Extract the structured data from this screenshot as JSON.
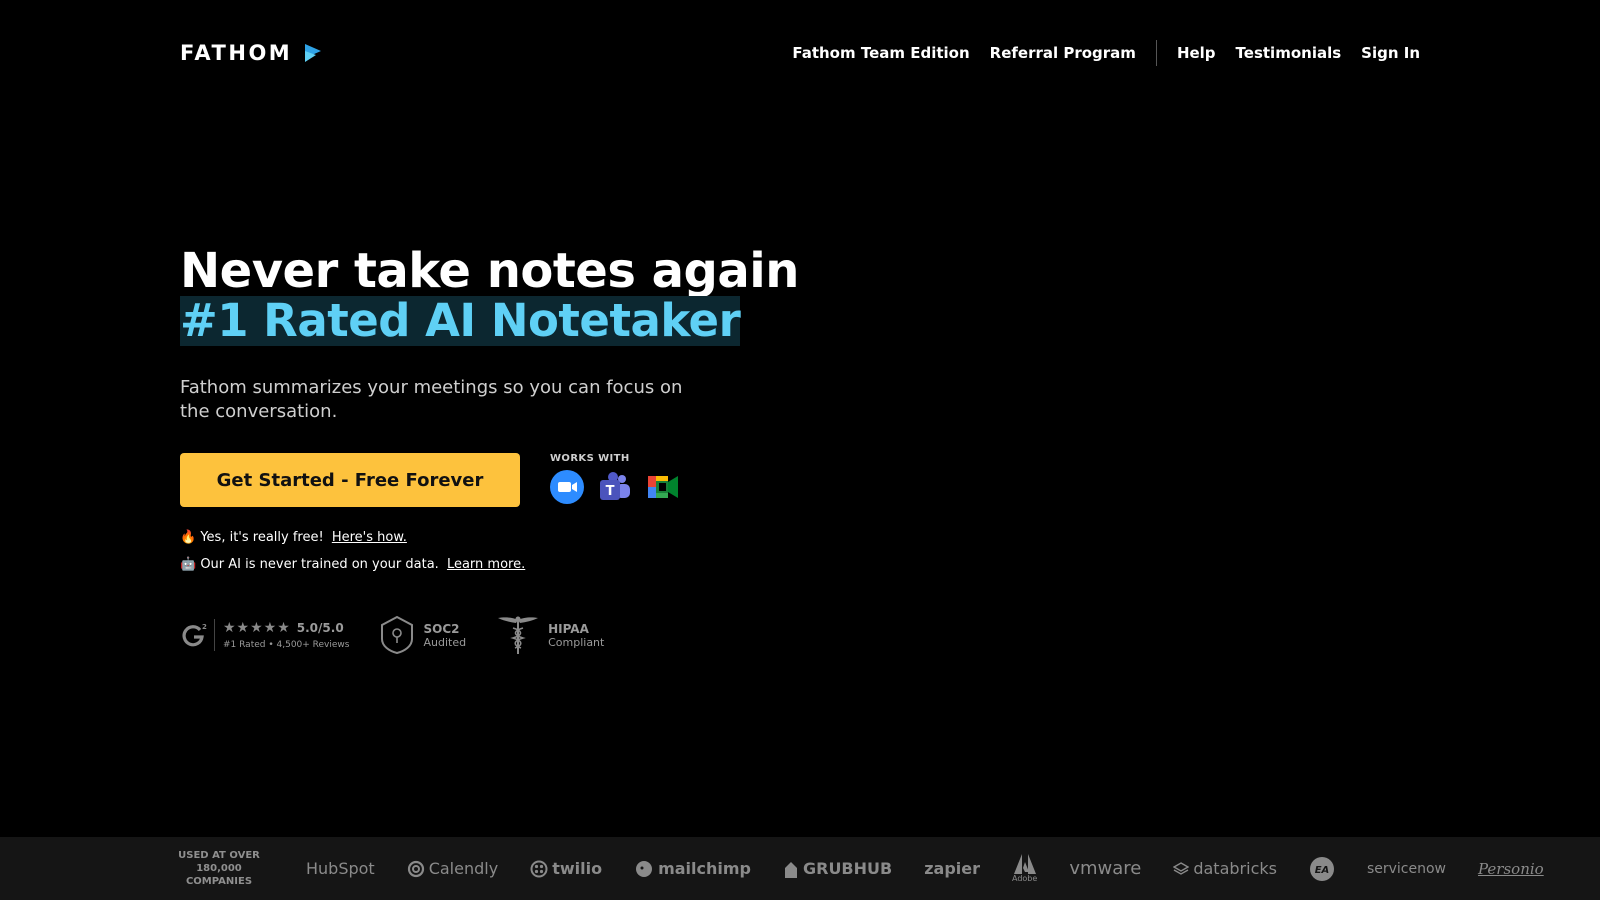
{
  "header": {
    "logo_text": "FATHOM",
    "nav": [
      "Fathom Team Edition",
      "Referral Program",
      "Help",
      "Testimonials",
      "Sign In"
    ]
  },
  "hero": {
    "headline": "Never take notes again",
    "subheadline": "#1 Rated AI Notetaker",
    "description": "Fathom summarizes your meetings so you can focus on the conversation.",
    "cta_label": "Get Started - Free Forever",
    "works_with_label": "WORKS WITH",
    "works_with_icons": [
      "zoom-icon",
      "microsoft-teams-icon",
      "google-meet-icon"
    ],
    "note1": {
      "emoji": "🔥",
      "text": "Yes, it's really free!",
      "link": "Here's how."
    },
    "note2": {
      "emoji": "🤖",
      "text": "Our AI is never trained on your data.",
      "link": "Learn more."
    }
  },
  "badges": {
    "g2": {
      "stars": "★★★★★",
      "rating": "5.0/5.0",
      "sub": "#1 Rated • 4,500+ Reviews"
    },
    "soc2": {
      "title": "SOC2",
      "sub": "Audited"
    },
    "hipaa": {
      "title": "HIPAA",
      "sub": "Compliant"
    }
  },
  "companies": {
    "label_line1": "USED AT OVER",
    "label_line2": "180,000 COMPANIES",
    "logos": [
      "HubSpot",
      "Calendly",
      "twilio",
      "mailchimp",
      "GRUBHUB",
      "zapier",
      "Adobe",
      "vmware",
      "databricks",
      "EA",
      "servicenow",
      "Personio"
    ]
  },
  "colors": {
    "background": "#000000",
    "accent_cyan": "#5fd0f5",
    "cta_yellow": "#fdc23d",
    "strip": "#151515"
  }
}
